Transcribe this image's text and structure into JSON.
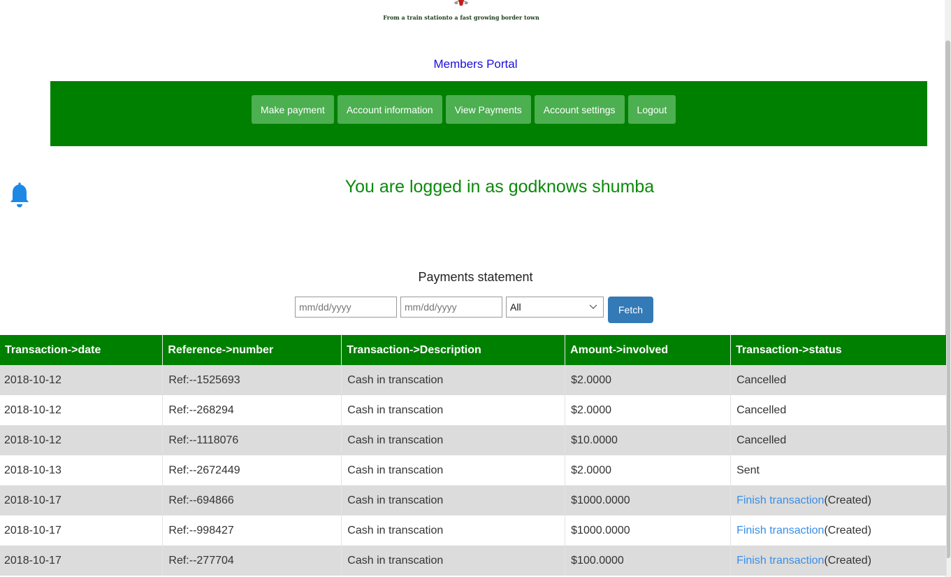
{
  "header": {
    "tagline": "From a train stationto a fast growing border town",
    "portal_title": "Members Portal"
  },
  "nav": {
    "items": [
      {
        "label": "Make payment"
      },
      {
        "label": "Account information"
      },
      {
        "label": "View Payments"
      },
      {
        "label": "Account settings"
      },
      {
        "label": "Logout"
      }
    ]
  },
  "welcome": {
    "text": "You are logged in as godknows shumba"
  },
  "statement": {
    "title": "Payments statement",
    "from_placeholder": "mm/dd/yyyy",
    "to_placeholder": "mm/dd/yyyy",
    "status_selected": "All",
    "fetch_label": "Fetch"
  },
  "table": {
    "headers": [
      "Transaction->date",
      "Reference->number",
      "Transaction->Description",
      "Amount->involved",
      "Transaction->status"
    ],
    "rows": [
      {
        "date": "2018-10-12",
        "ref": "Ref:--1525693",
        "desc": "Cash in transcation",
        "amount": "$2.0000",
        "status": "Cancelled",
        "link": ""
      },
      {
        "date": "2018-10-12",
        "ref": "Ref:--268294",
        "desc": "Cash in transcation",
        "amount": "$2.0000",
        "status": "Cancelled",
        "link": ""
      },
      {
        "date": "2018-10-12",
        "ref": "Ref:--1118076",
        "desc": "Cash in transcation",
        "amount": "$10.0000",
        "status": "Cancelled",
        "link": ""
      },
      {
        "date": "2018-10-13",
        "ref": "Ref:--2672449",
        "desc": "Cash in transcation",
        "amount": "$2.0000",
        "status": "Sent",
        "link": ""
      },
      {
        "date": "2018-10-17",
        "ref": "Ref:--694866",
        "desc": "Cash in transcation",
        "amount": "$1000.0000",
        "status": "(Created)",
        "link": "Finish transaction"
      },
      {
        "date": "2018-10-17",
        "ref": "Ref:--998427",
        "desc": "Cash in transcation",
        "amount": "$1000.0000",
        "status": "(Created)",
        "link": "Finish transaction"
      },
      {
        "date": "2018-10-17",
        "ref": "Ref:--277704",
        "desc": "Cash in transcation",
        "amount": "$100.0000",
        "status": "(Created)",
        "link": "Finish transaction"
      }
    ]
  },
  "colors": {
    "nav_green": "#008000",
    "button_green": "#4caf50",
    "fetch_blue": "#337ab7",
    "bell_blue": "#1e88e5",
    "link_blue": "#3a8ee6",
    "portal_title_blue": "#1a0dde"
  },
  "icons": {
    "bell": "bell-icon",
    "select": "chevron-down-icon",
    "logo": "crest-emblem"
  }
}
